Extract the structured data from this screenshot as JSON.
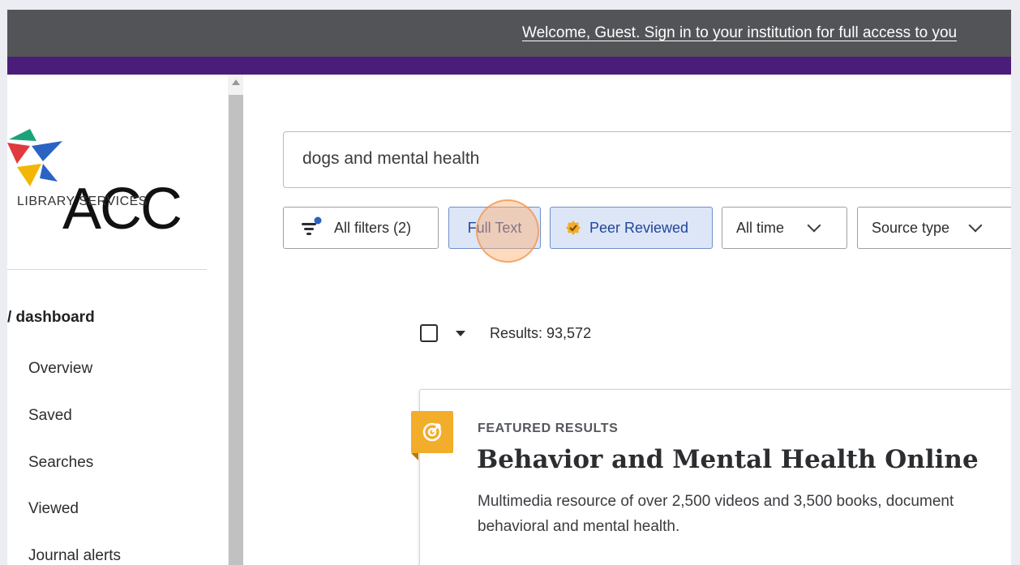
{
  "banner": {
    "welcome_text": "Welcome, Guest. Sign in to your institution for full access to you"
  },
  "logo": {
    "name": "ACC",
    "subtitle": "LIBRARY SERVICES"
  },
  "sidebar": {
    "dashboard_title": "/ dashboard",
    "items": [
      {
        "label": "Overview"
      },
      {
        "label": "Saved"
      },
      {
        "label": "Searches"
      },
      {
        "label": "Viewed"
      },
      {
        "label": "Journal alerts"
      }
    ]
  },
  "search": {
    "query": "dogs and mental health"
  },
  "filters": {
    "all_filters_label": "All filters (2)",
    "full_text_label": "Full Text",
    "full_text_active": true,
    "peer_reviewed_label": "Peer Reviewed",
    "peer_reviewed_active": true,
    "time_label": "All time",
    "source_type_label": "Source type"
  },
  "results": {
    "count_text": "Results: 93,572"
  },
  "featured": {
    "label": "FEATURED RESULTS",
    "title": "Behavior and Mental Health Online",
    "description": "Multimedia resource of over 2,500 videos and 3,500 books, document behavioral and mental health."
  },
  "colors": {
    "topbar": "#525457",
    "brand_purple": "#4b1d7a",
    "chip_active_bg": "#dde6f7",
    "featured_badge": "#f2ad2a"
  }
}
